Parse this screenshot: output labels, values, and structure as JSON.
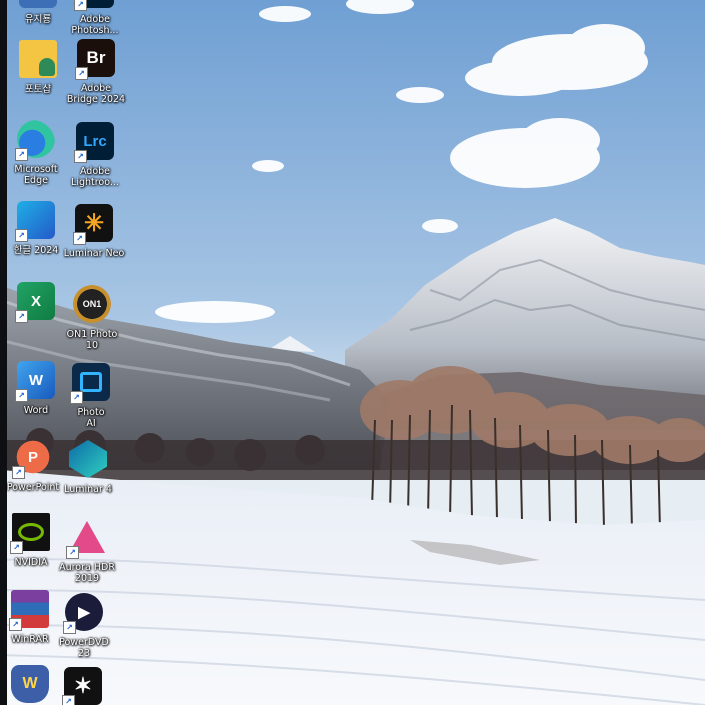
{
  "desktop": {
    "icons": [
      {
        "label": "유지룡",
        "icon": "app-icon"
      },
      {
        "label": "Adobe\nPhotosh...",
        "icon": "photoshop-icon"
      },
      {
        "label": "포토샵",
        "icon": "folder-user-icon"
      },
      {
        "label": "Adobe\nBridge 2024",
        "icon": "adobe-bridge-icon",
        "text": "Br"
      },
      {
        "label": "Microsoft\nEdge",
        "icon": "edge-icon"
      },
      {
        "label": "Adobe\nLightroo...",
        "icon": "lightroom-classic-icon",
        "text": "Lrc"
      },
      {
        "label": "한글 2024",
        "icon": "hangul-icon"
      },
      {
        "label": "Luminar Neo",
        "icon": "luminar-neo-icon"
      },
      {
        "label": "",
        "icon": "excel-icon",
        "text": "X"
      },
      {
        "label": "ON1 Photo\n10",
        "icon": "on1-photo-icon",
        "text": "ON1"
      },
      {
        "label": "Word",
        "icon": "word-icon",
        "text": "W"
      },
      {
        "label": "Photo\nAI",
        "icon": "photo-ai-icon"
      },
      {
        "label": "PowerPoint",
        "icon": "powerpoint-icon",
        "text": "P"
      },
      {
        "label": "Luminar 4",
        "icon": "luminar-4-icon"
      },
      {
        "label": "NVIDIA",
        "icon": "nvidia-icon"
      },
      {
        "label": "Aurora HDR\n2019",
        "icon": "aurora-hdr-icon"
      },
      {
        "label": "WinRAR",
        "icon": "winrar-icon"
      },
      {
        "label": "PowerDVD\n23",
        "icon": "powerdvd-icon"
      },
      {
        "label": "",
        "icon": "shield-app-icon"
      },
      {
        "label": "",
        "icon": "star-app-icon"
      }
    ]
  },
  "colors": {
    "sky_top": "#7faad6",
    "sky_bottom": "#dde9f2",
    "snow": "#f4f7fb"
  }
}
